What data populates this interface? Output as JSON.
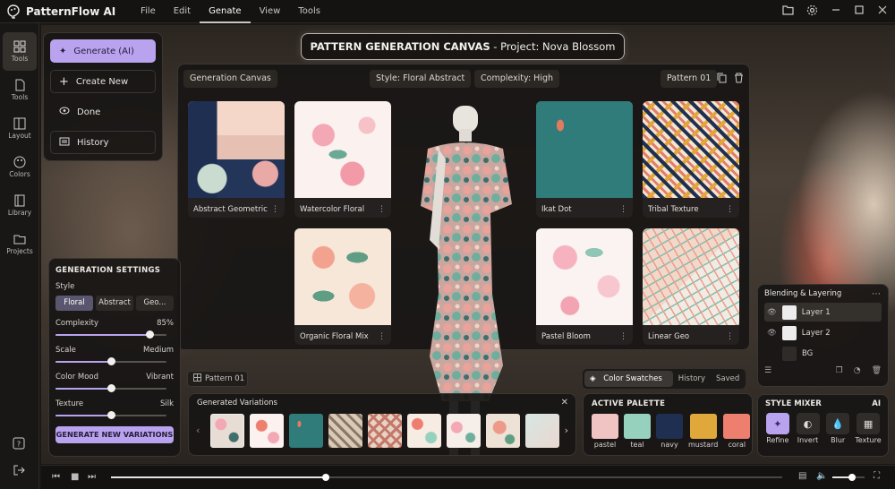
{
  "app": {
    "name": "PatternFlow AI"
  },
  "menu": [
    "File",
    "Edit",
    "Genate",
    "View",
    "Tools"
  ],
  "rail": [
    {
      "label": "Tools"
    },
    {
      "label": "Tools"
    },
    {
      "label": "Layout"
    },
    {
      "label": "Colors"
    },
    {
      "label": "Library"
    },
    {
      "label": "Projects"
    }
  ],
  "gen_menu": {
    "generate": "Generate (AI)",
    "create_new": "Create New",
    "done": "Done",
    "history": "History"
  },
  "canvas_title": {
    "bold": "PATTERN GENERATION CANVAS",
    "rest": " - Project: Nova Blossom"
  },
  "main": {
    "tab": "Generation Canvas",
    "style": "Style: Floral Abstract",
    "complexity": "Complexity: High",
    "pattern": "Pattern 01"
  },
  "cards": [
    {
      "label": "Abstract Geometric"
    },
    {
      "label": "Watercolor Floral"
    },
    {
      "label": "Ikat Dot"
    },
    {
      "label": "Tribal Texture"
    },
    {
      "label": "Organic Floral Mix"
    },
    {
      "label": "Pastel Bloom"
    },
    {
      "label": "Linear Geo"
    }
  ],
  "settings": {
    "title": "GENERATION SETTINGS",
    "style_label": "Style",
    "style_options": [
      "Floral",
      "Abstract",
      "Geo..."
    ],
    "complexity_label": "Complexity",
    "complexity_value": "85%",
    "complexity_level": 0.85,
    "scale_label": "Scale",
    "scale_value": "Medium",
    "scale_level": 0.5,
    "mood_label": "Color Mood",
    "mood_value": "Vibrant",
    "mood_level": 0.5,
    "texture_label": "Texture",
    "texture_value": "Silk",
    "texture_level": 0.5,
    "button": "GENERATE NEW VARIATIONS"
  },
  "pattern_chip": "Pattern 01",
  "variations": {
    "title": "Generated Variations"
  },
  "swatch_tabs": [
    "Color Swatches",
    "History",
    "Saved"
  ],
  "palette": {
    "title": "ACTIVE PALETTE",
    "colors": [
      {
        "name": "pastel",
        "hex": "#f1c4c4"
      },
      {
        "name": "teal",
        "hex": "#96d1bd"
      },
      {
        "name": "navy",
        "hex": "#1e2f52"
      },
      {
        "name": "mustard",
        "hex": "#e0a83a"
      },
      {
        "name": "coral",
        "hex": "#ee7f6e"
      }
    ]
  },
  "blend": {
    "title": "Blending & Layering",
    "layers": [
      "Layer 1",
      "Layer 2",
      "BG"
    ]
  },
  "mixer": {
    "title": "STYLE MIXER",
    "badge": "AI",
    "items": [
      "Refine",
      "Invert",
      "Blur",
      "Texture"
    ]
  },
  "playback": {
    "progress": 0.32,
    "volume": 0.6
  }
}
